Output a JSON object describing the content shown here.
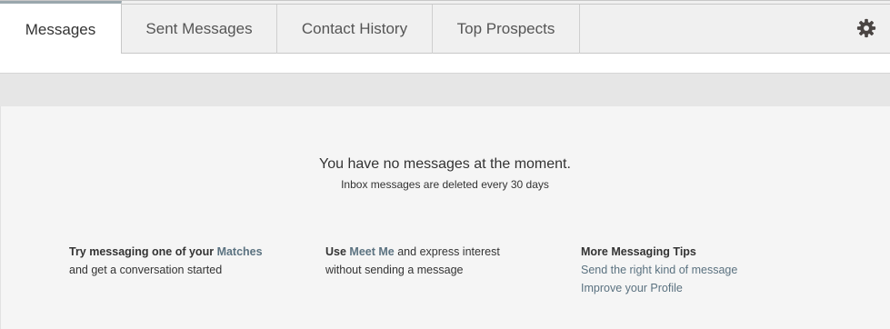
{
  "tabs": {
    "messages": "Messages",
    "sent": "Sent Messages",
    "history": "Contact History",
    "prospects": "Top Prospects"
  },
  "empty_state": {
    "title": "You have no messages at the moment.",
    "subtitle": "Inbox messages are deleted every 30 days"
  },
  "tips": {
    "col1": {
      "prefix": "Try messaging one of your",
      "link": "Matches",
      "line2": "and get a conversation started"
    },
    "col2": {
      "prefix": "Use",
      "link": "Meet Me",
      "suffix": "and express interest",
      "line2": "without sending a message"
    },
    "col3": {
      "heading": "More Messaging Tips",
      "link1": "Send the right kind of message",
      "link2": "Improve your Profile"
    }
  },
  "icons": {
    "settings": "gear-icon"
  },
  "colors": {
    "link": "#5b7280",
    "active_tab_border": "#9aa7ad"
  }
}
